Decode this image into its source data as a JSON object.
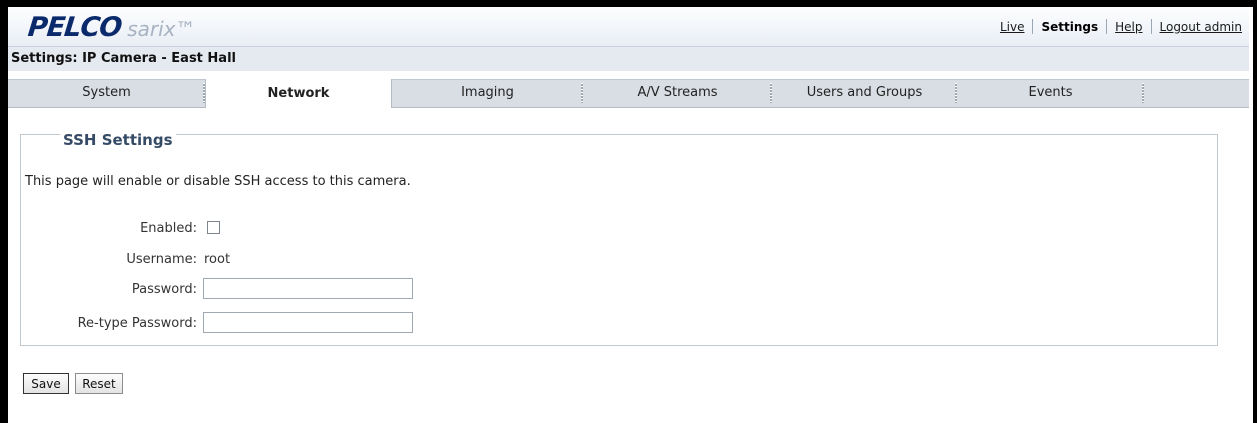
{
  "brand": {
    "logo_main": "PELCO",
    "logo_sub": "sarix™"
  },
  "topnav": {
    "live": "Live",
    "settings": "Settings",
    "help": "Help",
    "logout": "Logout admin"
  },
  "breadcrumb": "Settings: IP Camera - East Hall",
  "tabs": [
    {
      "label": "System"
    },
    {
      "label": "Network",
      "active": true
    },
    {
      "label": "Imaging"
    },
    {
      "label": "A/V Streams"
    },
    {
      "label": "Users and Groups"
    },
    {
      "label": "Events"
    }
  ],
  "ssh": {
    "title": "SSH Settings",
    "description": "This page will enable or disable SSH access to this camera.",
    "enabled_label": "Enabled:",
    "enabled_checked": false,
    "username_label": "Username:",
    "username_value": "root",
    "password_label": "Password:",
    "password_value": "",
    "retype_label": "Re-type Password:",
    "retype_value": ""
  },
  "actions": {
    "save": "Save",
    "reset": "Reset"
  }
}
